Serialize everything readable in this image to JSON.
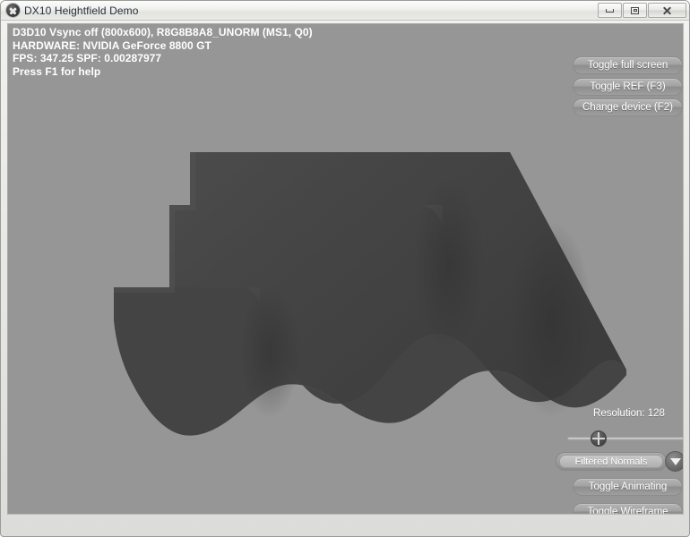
{
  "window": {
    "title": "DX10 Heightfield Demo",
    "icon": "app-circle-x-icon",
    "controls": {
      "minimize": "Minimize",
      "maximize": "Restore",
      "close": "Close"
    }
  },
  "hud": {
    "lines": [
      "D3D10 Vsync off (800x600), R8G8B8A8_UNORM (MS1, Q0)",
      "HARDWARE: NVIDIA GeForce 8800 GT",
      "FPS: 347.25  SPF: 0.00287977",
      "Press F1 for help"
    ],
    "device_line": "D3D10 Vsync off (800x600), R8G8B8A8_UNORM (MS1, Q0)",
    "hardware_line": "HARDWARE: NVIDIA GeForce 8800 GT",
    "perf_line": "FPS: 347.25  SPF: 0.00287977",
    "help_line": "Press F1 for help"
  },
  "top_buttons": {
    "toggle_fullscreen": "Toggle full screen",
    "toggle_ref": "Toggle REF (F3)",
    "change_device": "Change device (F2)"
  },
  "controls": {
    "resolution_label": "Resolution: 128",
    "resolution_value": 128,
    "slider_percent": 20,
    "technique_selected": "Filtered Normals",
    "technique_options": [
      "Filtered Normals"
    ],
    "dropdown_icon": "chevron-down-icon",
    "toggle_animating": "Toggle Animating",
    "toggle_wireframe": "Toggle Wireframe"
  },
  "colors": {
    "viewport_background": "#969696",
    "mesh_base": "#4a4a4a",
    "mesh_shadow": "#3d3d3d",
    "mesh_highlight": "#555555",
    "hud_text": "#ffffff",
    "title_text": "#26303c",
    "window_chrome": "#e6e6e4"
  },
  "scene": {
    "description": "Stepped heightfield terrain mesh with sinusoidal front edge",
    "plateau_levels": 3
  }
}
